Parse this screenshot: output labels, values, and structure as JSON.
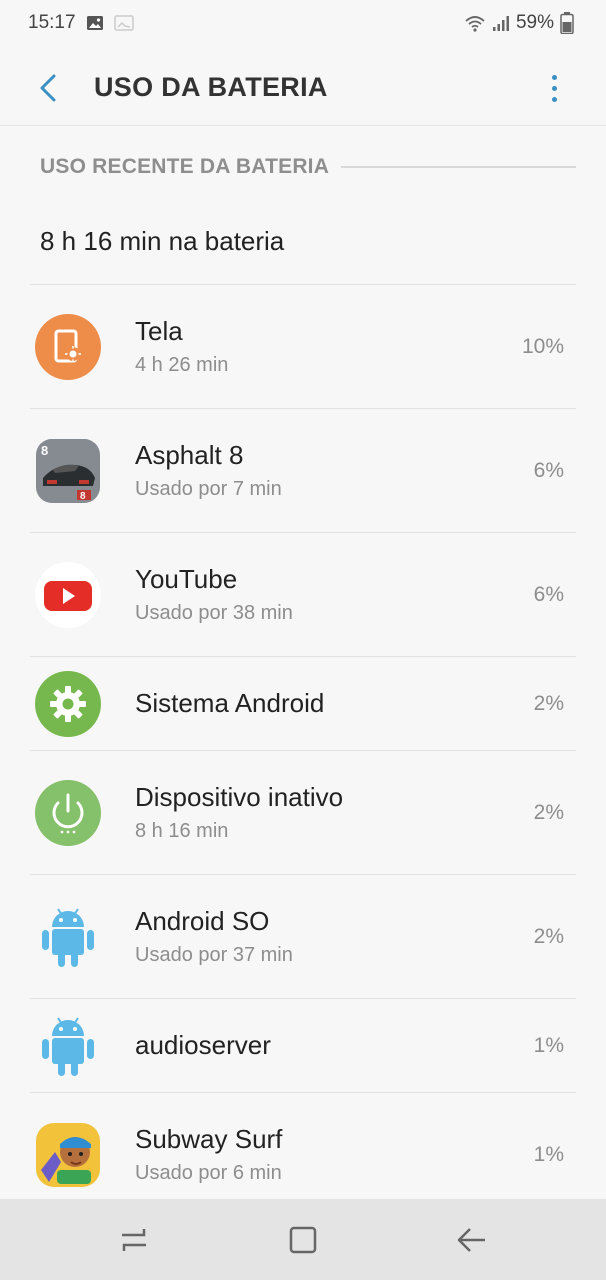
{
  "status_bar": {
    "time": "15:17",
    "battery_percent": "59%"
  },
  "app_bar": {
    "title": "USO DA BATERIA"
  },
  "section": {
    "header": "USO RECENTE DA BATERIA",
    "summary": "8 h 16 min na bateria"
  },
  "apps": [
    {
      "name": "Tela",
      "sub": "4 h 26 min",
      "percent": "10%",
      "icon": "screen-brightness-icon"
    },
    {
      "name": "Asphalt 8",
      "sub": "Usado por 7 min",
      "percent": "6%",
      "icon": "asphalt-8-app-icon"
    },
    {
      "name": "YouTube",
      "sub": "Usado por 38 min",
      "percent": "6%",
      "icon": "youtube-app-icon"
    },
    {
      "name": "Sistema Android",
      "sub": "",
      "percent": "2%",
      "icon": "settings-gear-icon"
    },
    {
      "name": "Dispositivo inativo",
      "sub": "8 h 16 min",
      "percent": "2%",
      "icon": "power-idle-icon"
    },
    {
      "name": "Android SO",
      "sub": "Usado por 37 min",
      "percent": "2%",
      "icon": "android-robot-icon"
    },
    {
      "name": "audioserver",
      "sub": "",
      "percent": "1%",
      "icon": "android-robot-icon"
    },
    {
      "name": "Subway Surf",
      "sub": "Usado por 6 min",
      "percent": "1%",
      "icon": "subway-surf-app-icon"
    }
  ],
  "colors": {
    "accent": "#3a8fc4",
    "tela_orange": "#ee8c4a",
    "android_blue": "#5cb8e6",
    "green": "#77b84e",
    "youtube_red": "#e52d27"
  }
}
